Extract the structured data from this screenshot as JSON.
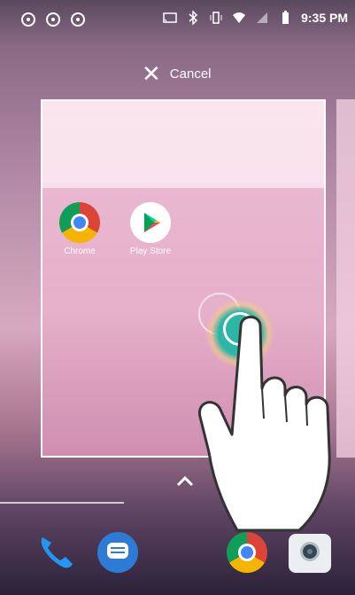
{
  "status_bar": {
    "time": "9:35 PM",
    "left_icons": [
      "settings-icon",
      "settings-icon",
      "settings-icon"
    ],
    "right_icons": [
      "cast-icon",
      "bluetooth-icon",
      "vibrate-icon",
      "wifi-icon",
      "no-sim-icon",
      "battery-icon"
    ]
  },
  "cancel": {
    "label": "Cancel",
    "icon": "close-icon"
  },
  "preview": {
    "apps": [
      {
        "label": "Chrome",
        "icon": "chrome-icon"
      },
      {
        "label": "Play Store",
        "icon": "play-store-icon"
      }
    ]
  },
  "dock": {
    "apps": [
      {
        "icon": "phone-icon"
      },
      {
        "icon": "messages-icon"
      },
      {
        "icon": "chrome-icon"
      },
      {
        "icon": "camera-icon"
      }
    ]
  },
  "colors": {
    "accent_teal": "#2fb5a6",
    "chrome_blue": "#4285f4"
  }
}
